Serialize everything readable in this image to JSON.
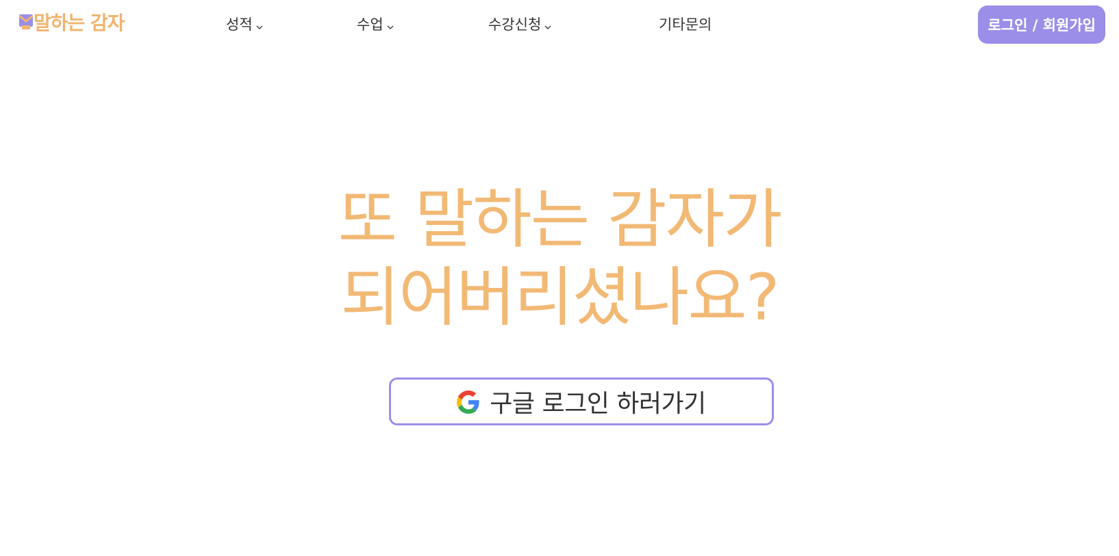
{
  "header": {
    "logo": {
      "text": "말하는 감자",
      "icon": "potato-mascot-icon"
    },
    "nav": [
      {
        "label": "성적",
        "has_dropdown": true
      },
      {
        "label": "수업",
        "has_dropdown": true
      },
      {
        "label": "수강신청",
        "has_dropdown": true
      },
      {
        "label": "기타문의",
        "has_dropdown": false
      }
    ],
    "login_button": "로그인 / 회원가입"
  },
  "hero": {
    "line1": "또 말하는 감자가",
    "line2": "되어버리셨나요?"
  },
  "google_login": {
    "label": "구글 로그인 하러가기",
    "icon": "google-g-icon"
  },
  "colors": {
    "accent_orange": "#f2b975",
    "accent_purple": "#9b8ee8",
    "text": "#333333",
    "background": "#ffffff"
  }
}
